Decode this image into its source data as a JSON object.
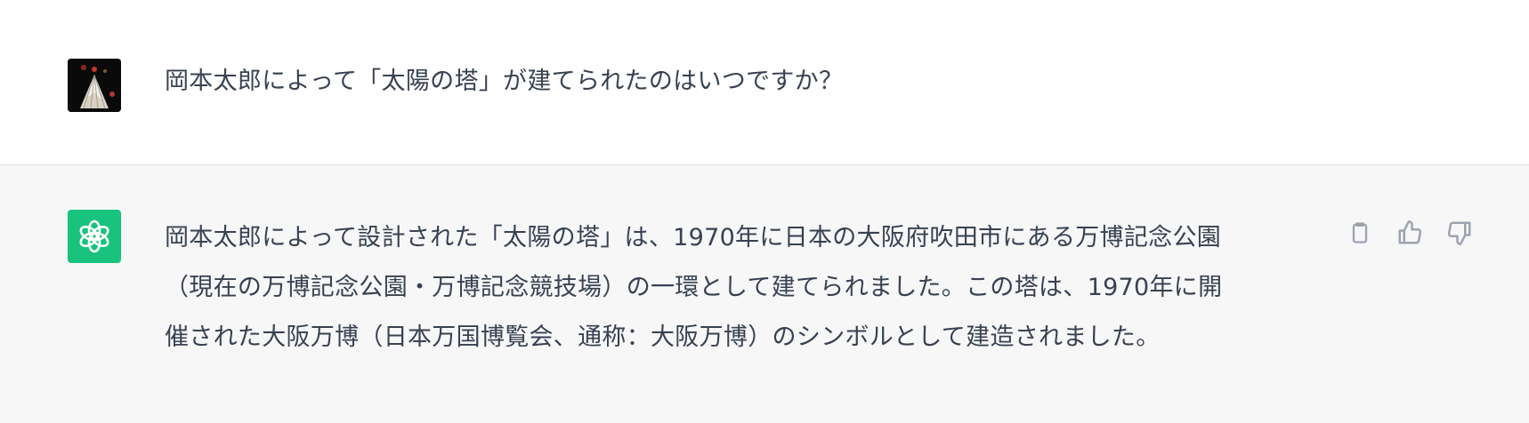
{
  "messages": {
    "user": {
      "avatar_icon": "user-avatar-mountain-image",
      "text": "岡本太郎によって「太陽の塔」が建てられたのはいつですか？"
    },
    "assistant": {
      "avatar_icon": "openai-logo-icon",
      "avatar_color": "#19c37d",
      "lines": [
        "岡本太郎によって設計された「太陽の塔」は、1970年に日本の大阪府吹田市にある万博記念公園",
        "（現在の万博記念公園・万博記念競技場）の一環として建てられました。この塔は、1970年に開",
        "催された大阪万博（日本万国博覧会、通称：大阪万博）のシンボルとして建造されました。"
      ],
      "actions": [
        {
          "icon": "clipboard-icon",
          "label": "Copy"
        },
        {
          "icon": "thumbs-up-icon",
          "label": "Good response"
        },
        {
          "icon": "thumbs-down-icon",
          "label": "Bad response"
        }
      ]
    }
  },
  "colors": {
    "user_bg": "#ffffff",
    "assistant_bg": "#f7f7f8",
    "text": "#374151",
    "icon": "#9ca3af"
  }
}
